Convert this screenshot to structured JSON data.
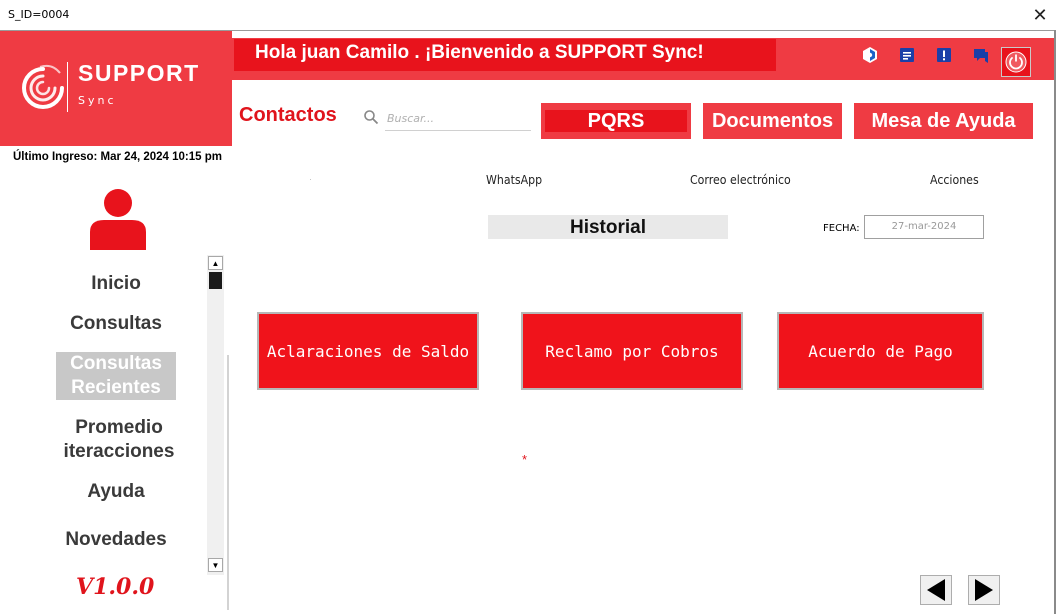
{
  "window": {
    "title": "S_ID=0004",
    "close_glyph": "✕"
  },
  "logo": {
    "name": "SUPPORT",
    "sub": "Sync"
  },
  "user": {
    "last_login": "Último Ingreso: Mar 24, 2024 10:15 pm"
  },
  "sidebar": {
    "items": [
      {
        "label": "Inicio"
      },
      {
        "label": "Consultas"
      },
      {
        "label": "Consultas Recientes",
        "selected": true
      },
      {
        "label": "Promedio iteracciones"
      },
      {
        "label": "Ayuda"
      },
      {
        "label": "Novedades"
      }
    ],
    "version": "V1.0.0"
  },
  "header": {
    "welcome": "Hola juan Camilo . ¡Bienvenido a SUPPORT Sync!",
    "icons": [
      "settings-icon",
      "notes-icon",
      "alert-icon",
      "chat-icon",
      "power-icon"
    ]
  },
  "toolbar": {
    "contactos": "Contactos",
    "search_placeholder": "Buscar...",
    "pqrs": "PQRS",
    "documentos": "Documentos",
    "mesa": "Mesa de Ayuda"
  },
  "columns": {
    "dot": "·",
    "whatsapp": "WhatsApp",
    "correo": "Correo electrónico",
    "acciones": "Acciones"
  },
  "historial": {
    "title": "Historial",
    "fecha_label": "FECHA:",
    "fecha_value": "27-mar-2024"
  },
  "actions": {
    "aclaraciones": "Aclaraciones de Saldo",
    "reclamo": "Reclamo por Cobros",
    "acuerdo": "Acuerdo de Pago"
  },
  "marker": "*",
  "colors": {
    "brand_red": "#ef3b43",
    "strong_red": "#e8131c",
    "text_red": "#e0141c"
  }
}
